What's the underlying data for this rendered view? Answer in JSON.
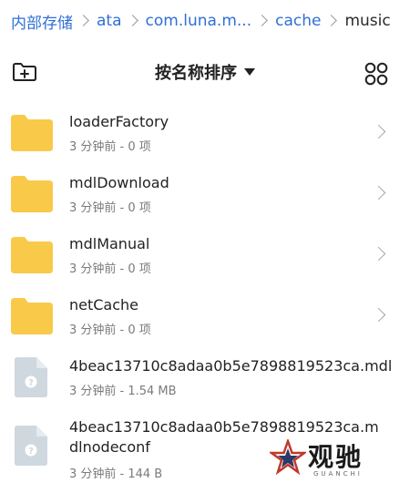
{
  "theme": {
    "accent": "#2f6fd6",
    "folder": "#f9c949",
    "file": "#cfd8df"
  },
  "breadcrumb": [
    "内部存储",
    "ata",
    "com.luna.m...",
    "cache",
    "music"
  ],
  "toolbar": {
    "left_icon": "new-folder-icon",
    "sort_label": "按名称排序",
    "right_icon": "grid-view-icon"
  },
  "items": [
    {
      "type": "folder",
      "name": "loaderFactory",
      "meta": "3 分钟前 - 0 项"
    },
    {
      "type": "folder",
      "name": "mdlDownload",
      "meta": "3 分钟前 - 0 项"
    },
    {
      "type": "folder",
      "name": "mdlManual",
      "meta": "3 分钟前 - 0 项"
    },
    {
      "type": "folder",
      "name": "netCache",
      "meta": "3 分钟前 - 0 项"
    },
    {
      "type": "file",
      "name": "4beac13710c8adaa0b5e7898819523ca.mdl",
      "meta": "3 分钟前 - 1.54 MB"
    },
    {
      "type": "file",
      "name": "4beac13710c8adaa0b5e7898819523ca.mdlnodeconf",
      "meta": "3 分钟前 - 144 B"
    }
  ],
  "watermark": {
    "text": "观驰",
    "sub": "GUANCHI"
  }
}
